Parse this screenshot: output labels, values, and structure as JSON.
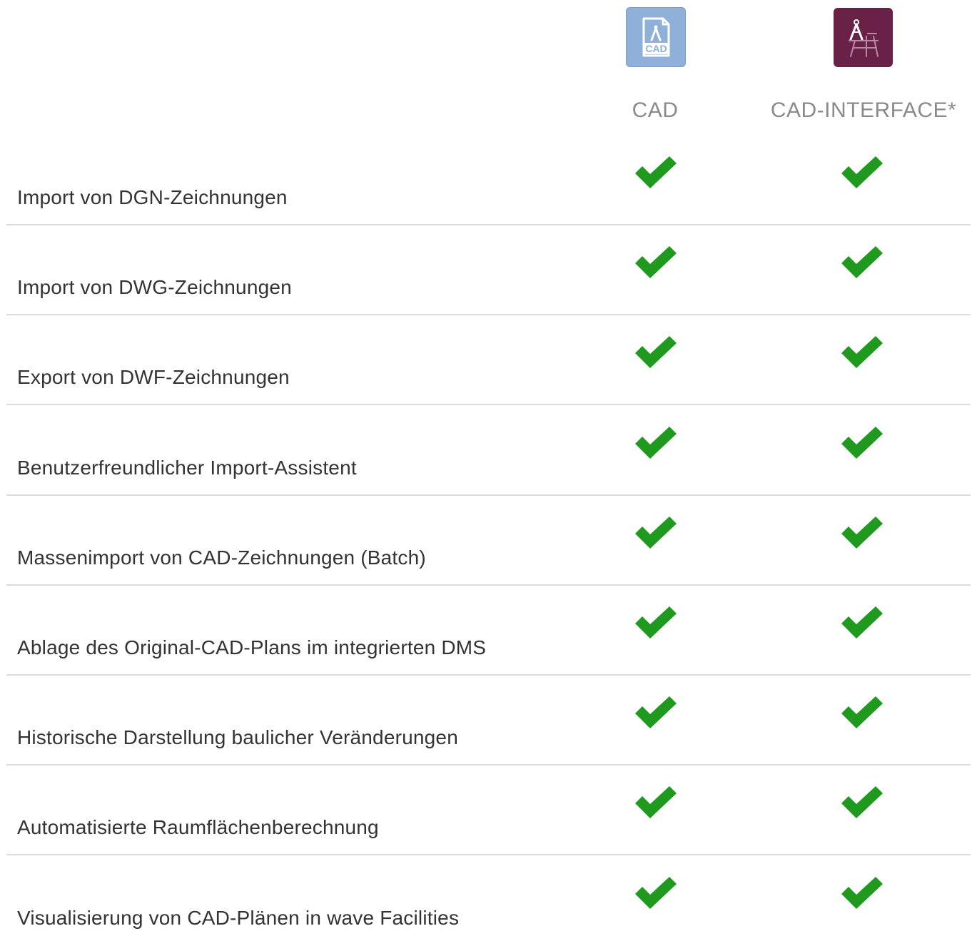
{
  "products": [
    {
      "label": "CAD",
      "icon": "cad-file-icon",
      "icon_text": "CAD",
      "color": "#8fb0d8"
    },
    {
      "label": "CAD-INTERFACE*",
      "icon": "drafting-compass-icon",
      "color": "#6a2148"
    }
  ],
  "check_color": "#1f9a1f",
  "features": [
    {
      "label": "Import von DGN-Zeichnungen",
      "cad": true,
      "cad_interface": true
    },
    {
      "label": "Import von DWG-Zeichnungen",
      "cad": true,
      "cad_interface": true
    },
    {
      "label": "Export von DWF-Zeichnungen",
      "cad": true,
      "cad_interface": true
    },
    {
      "label": "Benutzerfreundlicher Import-Assistent",
      "cad": true,
      "cad_interface": true
    },
    {
      "label": "Massenimport von CAD-Zeichnungen (Batch)",
      "cad": true,
      "cad_interface": true
    },
    {
      "label": "Ablage des Original-CAD-Plans im integrierten DMS",
      "cad": true,
      "cad_interface": true
    },
    {
      "label": "Historische Darstellung baulicher Veränderungen",
      "cad": true,
      "cad_interface": true
    },
    {
      "label": "Automatisierte Raumflächenberechnung",
      "cad": true,
      "cad_interface": true
    },
    {
      "label": "Visualisierung von CAD-Plänen in wave Facilities",
      "cad": true,
      "cad_interface": true
    }
  ]
}
